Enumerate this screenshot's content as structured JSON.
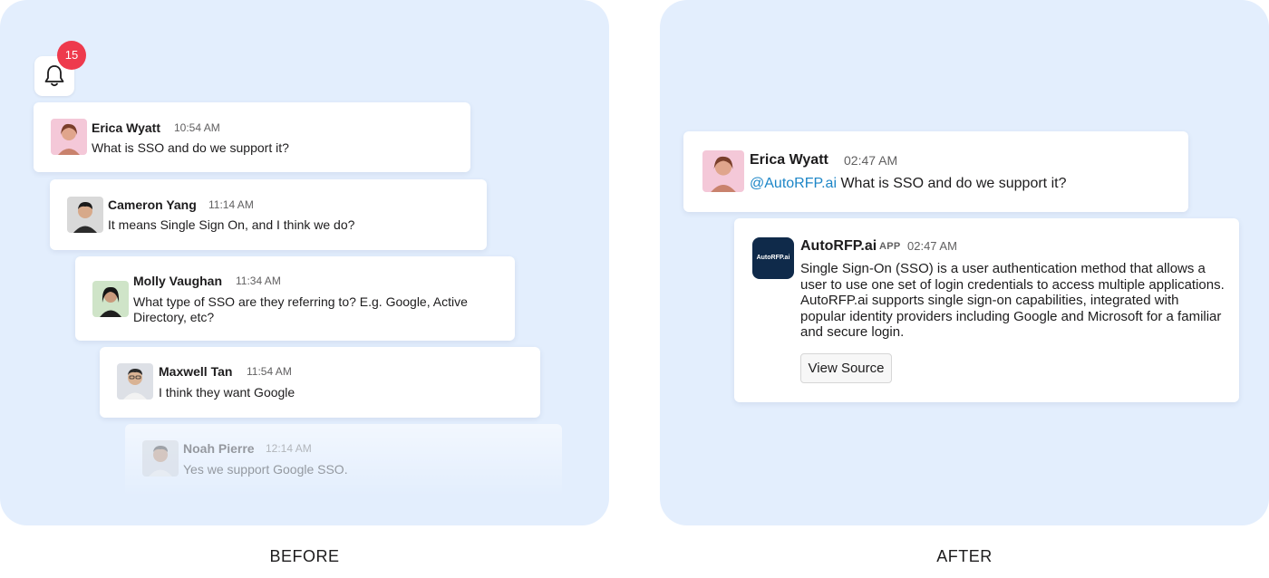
{
  "before": {
    "caption": "BEFORE",
    "notifications": {
      "count": "15",
      "icon": "bell-icon"
    },
    "messages": [
      {
        "name": "Erica Wyatt",
        "time": "10:54 AM",
        "text": "What is SSO and do we support it?",
        "avatar_color": "#f4c8d8"
      },
      {
        "name": "Cameron Yang",
        "time": "11:14 AM",
        "text": "It means Single Sign On, and I think we do?",
        "avatar_color": "#d9d9d9"
      },
      {
        "name": "Molly Vaughan",
        "time": "11:34 AM",
        "text": "What type of SSO are they referring to? E.g. Google, Active Directory, etc?",
        "avatar_color": "#cfe4c8"
      },
      {
        "name": "Maxwell Tan",
        "time": "11:54 AM",
        "text": "I think they want Google",
        "avatar_color": "#dde0e6"
      },
      {
        "name": "Noah Pierre",
        "time": "12:14 AM",
        "text": "Yes we support Google SSO.",
        "avatar_color": "#cfd3da"
      }
    ]
  },
  "after": {
    "caption": "AFTER",
    "question": {
      "name": "Erica Wyatt",
      "time": "02:47 AM",
      "mention": "@AutoRFP.ai",
      "text": " What is SSO and do we support it?"
    },
    "answer": {
      "name": "AutoRFP.ai",
      "tag": "APP",
      "time": "02:47 AM",
      "logo_text": "AutoRFP.ai",
      "text": "Single Sign-On (SSO) is a user authentication method that allows a user to use one set of login credentials to access multiple applications. AutoRFP.ai supports single sign-on capabilities, integrated with popular identity providers including Google and Microsoft for a familiar and secure login.",
      "button": "View Source"
    }
  },
  "colors": {
    "panel": "#e3eefd",
    "badge": "#ee3a4d",
    "mention": "#1d86c7"
  }
}
